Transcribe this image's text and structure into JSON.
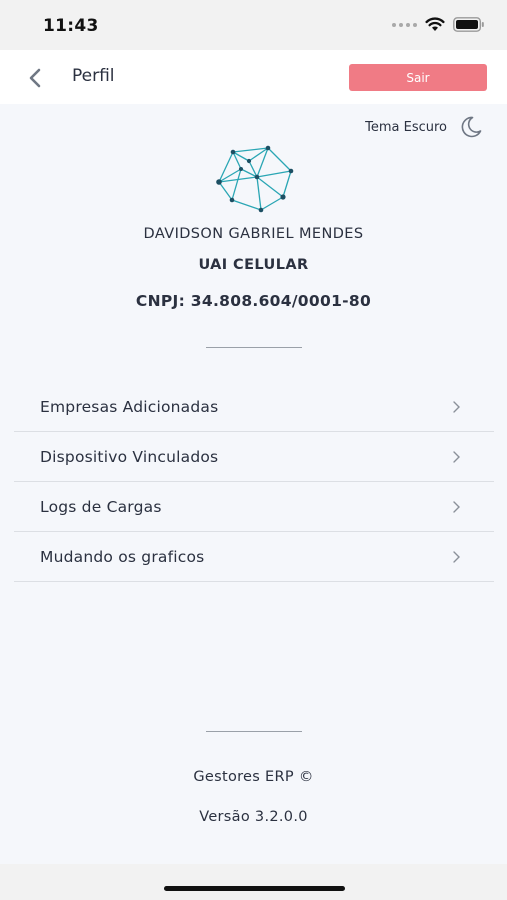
{
  "status_bar": {
    "time": "11:43"
  },
  "header": {
    "title": "Perfil",
    "logout_label": "Sair"
  },
  "theme": {
    "label": "Tema Escuro",
    "icon": "moon-icon"
  },
  "profile": {
    "user_name": "DAVIDSON GABRIEL MENDES",
    "company": "UAI CELULAR",
    "cnpj": "CNPJ: 34.808.604/0001-80"
  },
  "menu": {
    "items": [
      {
        "label": "Empresas Adicionadas"
      },
      {
        "label": "Dispositivo Vinculados"
      },
      {
        "label": "Logs de Cargas"
      },
      {
        "label": "Mudando os graficos"
      }
    ]
  },
  "footer": {
    "company": "Gestores ERP ©",
    "version": "Versão 3.2.0.0"
  },
  "colors": {
    "accent": "#f07b85",
    "logo": "#2aa6b4",
    "logo_nodes": "#1d4f63",
    "background": "#f5f7fb"
  }
}
